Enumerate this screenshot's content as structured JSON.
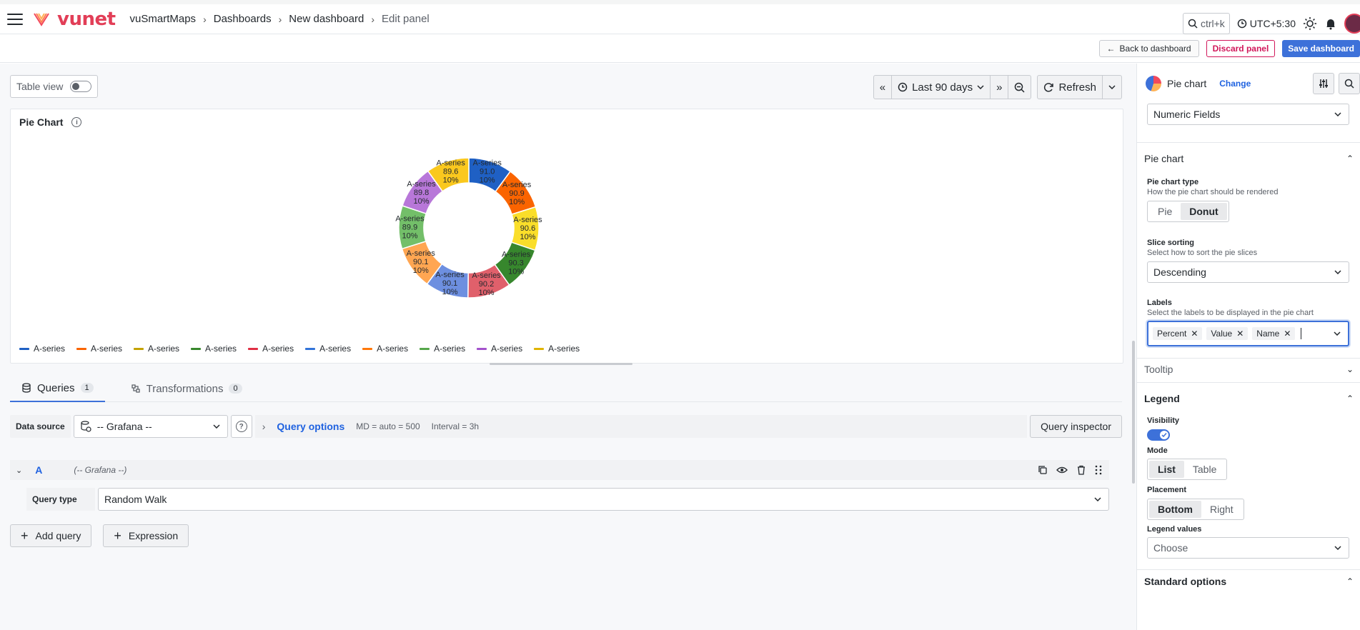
{
  "brand": {
    "logo_text": "vunet"
  },
  "breadcrumb": {
    "items": [
      "vuSmartMaps",
      "Dashboards",
      "New dashboard"
    ],
    "current": "Edit panel"
  },
  "header": {
    "search_shortcut": "ctrl+k",
    "timezone": "UTC+5:30"
  },
  "actions": {
    "back": "Back to dashboard",
    "discard": "Discard panel",
    "save": "Save dashboard"
  },
  "toolbar": {
    "table_view": "Table view",
    "time_range": "Last 90 days",
    "refresh": "Refresh"
  },
  "panel": {
    "title": "Pie Chart"
  },
  "chart_data": {
    "type": "donut",
    "title": "Pie Chart",
    "slices": [
      {
        "name": "A-series",
        "value": 91.0,
        "percent": "10%",
        "color": "#1f60c4"
      },
      {
        "name": "A-series",
        "value": 90.9,
        "percent": "10%",
        "color": "#fa6400"
      },
      {
        "name": "A-series",
        "value": 90.6,
        "percent": "10%",
        "color": "#fade2a"
      },
      {
        "name": "A-series",
        "value": 90.3,
        "percent": "10%",
        "color": "#37872d"
      },
      {
        "name": "A-series",
        "value": 90.2,
        "percent": "10%",
        "color": "#e0606b"
      },
      {
        "name": "A-series",
        "value": 90.1,
        "percent": "10%",
        "color": "#6d8fe0"
      },
      {
        "name": "A-series",
        "value": 90.1,
        "percent": "10%",
        "color": "#ffa652"
      },
      {
        "name": "A-series",
        "value": 89.9,
        "percent": "10%",
        "color": "#73bf69"
      },
      {
        "name": "A-series",
        "value": 89.8,
        "percent": "10%",
        "color": "#b877d9"
      },
      {
        "name": "A-series",
        "value": 89.6,
        "percent": "10%",
        "color": "#fac81e"
      }
    ],
    "legend": {
      "placement": "bottom",
      "mode": "list"
    },
    "value_labels": [
      "91.0",
      "90.9",
      "90.6",
      "90.3",
      "90.2",
      "90.1",
      "90.1",
      "89.9",
      "89.8",
      "89.6"
    ]
  },
  "legend_items": [
    {
      "label": "A-series",
      "color": "#1f60c4"
    },
    {
      "label": "A-series",
      "color": "#fa6400"
    },
    {
      "label": "A-series",
      "color": "#c4a200"
    },
    {
      "label": "A-series",
      "color": "#37872d"
    },
    {
      "label": "A-series",
      "color": "#e02f44"
    },
    {
      "label": "A-series",
      "color": "#3274d9"
    },
    {
      "label": "A-series",
      "color": "#ff780a"
    },
    {
      "label": "A-series",
      "color": "#56a64b"
    },
    {
      "label": "A-series",
      "color": "#a352cc"
    },
    {
      "label": "A-series",
      "color": "#e0b400"
    }
  ],
  "tabs": [
    {
      "label": "Queries",
      "count": "1"
    },
    {
      "label": "Transformations",
      "count": "0"
    }
  ],
  "query": {
    "ds_label": "Data source",
    "ds_value": "-- Grafana --",
    "options_label": "Query options",
    "md": "MD = auto = 500",
    "interval": "Interval = 3h",
    "inspector": "Query inspector",
    "row_letter": "A",
    "row_source": "(-- Grafana --)",
    "type_label": "Query type",
    "type_value": "Random Walk",
    "add_query": "Add query",
    "add_expression": "Expression"
  },
  "options": {
    "viz_name": "Pie chart",
    "change": "Change",
    "numeric_fields": "Numeric Fields",
    "pie_section": "Pie chart",
    "type_label": "Pie chart type",
    "type_desc": "How the pie chart should be rendered",
    "type_options": [
      "Pie",
      "Donut"
    ],
    "type_selected": "Donut",
    "sort_label": "Slice sorting",
    "sort_desc": "Select how to sort the pie slices",
    "sort_value": "Descending",
    "labels_label": "Labels",
    "labels_desc": "Select the labels to be displayed in the pie chart",
    "labels_chips": [
      "Percent",
      "Value",
      "Name"
    ],
    "tooltip_section": "Tooltip",
    "legend_section": "Legend",
    "visibility_label": "Visibility",
    "mode_label": "Mode",
    "mode_options": [
      "List",
      "Table"
    ],
    "placement_label": "Placement",
    "placement_options": [
      "Bottom",
      "Right"
    ],
    "legend_values_label": "Legend values",
    "legend_values_placeholder": "Choose",
    "standard_section": "Standard options"
  }
}
